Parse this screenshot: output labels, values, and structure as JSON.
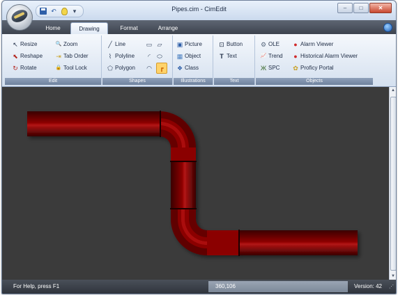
{
  "window": {
    "title": "Pipes.cim - CimEdit",
    "controls": {
      "minimize": "–",
      "maximize": "□",
      "close": "✕"
    }
  },
  "quick_access": {
    "items": [
      {
        "name": "save-icon"
      },
      {
        "name": "undo-icon",
        "glyph": "↶"
      },
      {
        "name": "light-bulb-icon"
      },
      {
        "name": "qat-dropdown-icon",
        "glyph": "▾"
      }
    ]
  },
  "tabs": [
    {
      "label": "Home",
      "active": false
    },
    {
      "label": "Drawing",
      "active": true
    },
    {
      "label": "Format",
      "active": false
    },
    {
      "label": "Arrange",
      "active": false
    }
  ],
  "ribbon": {
    "edit": {
      "label": "Edit",
      "items": [
        {
          "label": "Resize",
          "icon": "resize-icon",
          "glyph": "↖",
          "color": "#1d2b44"
        },
        {
          "label": "Zoom",
          "icon": "zoom-icon",
          "glyph": "🔍",
          "color": "#2e5fa8"
        },
        {
          "label": "Reshape",
          "icon": "reshape-icon",
          "glyph": "⬉",
          "color": "#b3261e"
        },
        {
          "label": "Tab Order",
          "icon": "tab-order-icon",
          "glyph": "⇥",
          "color": "#c9a227"
        },
        {
          "label": "Rotate",
          "icon": "rotate-icon",
          "glyph": "↻",
          "color": "#b3261e"
        },
        {
          "label": "Tool Lock",
          "icon": "lock-icon",
          "glyph": "🔒",
          "color": "#2e5fa8"
        }
      ]
    },
    "shapes": {
      "label": "Shapes",
      "items": [
        {
          "label": "Line",
          "icon": "line-icon",
          "glyph": "╱"
        },
        {
          "label": "Polyline",
          "icon": "polyline-icon",
          "glyph": "⌇"
        },
        {
          "label": "Polygon",
          "icon": "polygon-icon",
          "glyph": "⬠"
        }
      ],
      "extra_icons": [
        {
          "name": "rectangle-icon",
          "glyph": "▭"
        },
        {
          "name": "parallelogram-icon",
          "glyph": "▱"
        },
        {
          "name": "arc-icon",
          "glyph": "◜"
        },
        {
          "name": "ellipse-icon",
          "glyph": "⬭"
        },
        {
          "name": "chord-icon",
          "glyph": "◠"
        },
        {
          "name": "pipe-icon",
          "glyph": "┏"
        }
      ]
    },
    "illustrations": {
      "label": "Illustrations",
      "items": [
        {
          "label": "Picture",
          "icon": "picture-icon",
          "glyph": "▣",
          "color": "#2e5fa8"
        },
        {
          "label": "Object",
          "icon": "object-icon",
          "glyph": "▦",
          "color": "#4a7fc1"
        },
        {
          "label": "Class",
          "icon": "class-icon",
          "glyph": "❖",
          "color": "#2e5fa8"
        }
      ]
    },
    "text": {
      "label": "Text",
      "items": [
        {
          "label": "Button",
          "icon": "button-icon",
          "glyph": "⊡",
          "color": "#1d2b44"
        },
        {
          "label": "Text",
          "icon": "text-icon",
          "glyph": "T",
          "color": "#1d2b44"
        }
      ]
    },
    "objects": {
      "label": "Objects",
      "items": [
        {
          "label": "OLE",
          "icon": "ole-icon",
          "glyph": "⚙",
          "color": "#5a6b80"
        },
        {
          "label": "Alarm Viewer",
          "icon": "alarm-viewer-icon",
          "glyph": "●",
          "color": "#d02a2a"
        },
        {
          "label": "Trend",
          "icon": "trend-icon",
          "glyph": "📈",
          "color": "#b3261e"
        },
        {
          "label": "Historical Alarm Viewer",
          "icon": "historical-alarm-viewer-icon",
          "glyph": "●",
          "color": "#d02a2a"
        },
        {
          "label": "SPC",
          "icon": "spc-icon",
          "glyph": "Ж",
          "color": "#3d6b2f"
        },
        {
          "label": "Proficy Portal",
          "icon": "proficy-portal-icon",
          "glyph": "✿",
          "color": "#c9a227"
        }
      ]
    }
  },
  "status": {
    "help": "For Help, press F1",
    "coords": "360,106",
    "version": "Version: 42"
  },
  "colors": {
    "canvas_bg": "#3b3b3b",
    "pipe_dark": "#3a0000",
    "pipe_mid": "#8b0000",
    "pipe_light": "#b21414"
  }
}
